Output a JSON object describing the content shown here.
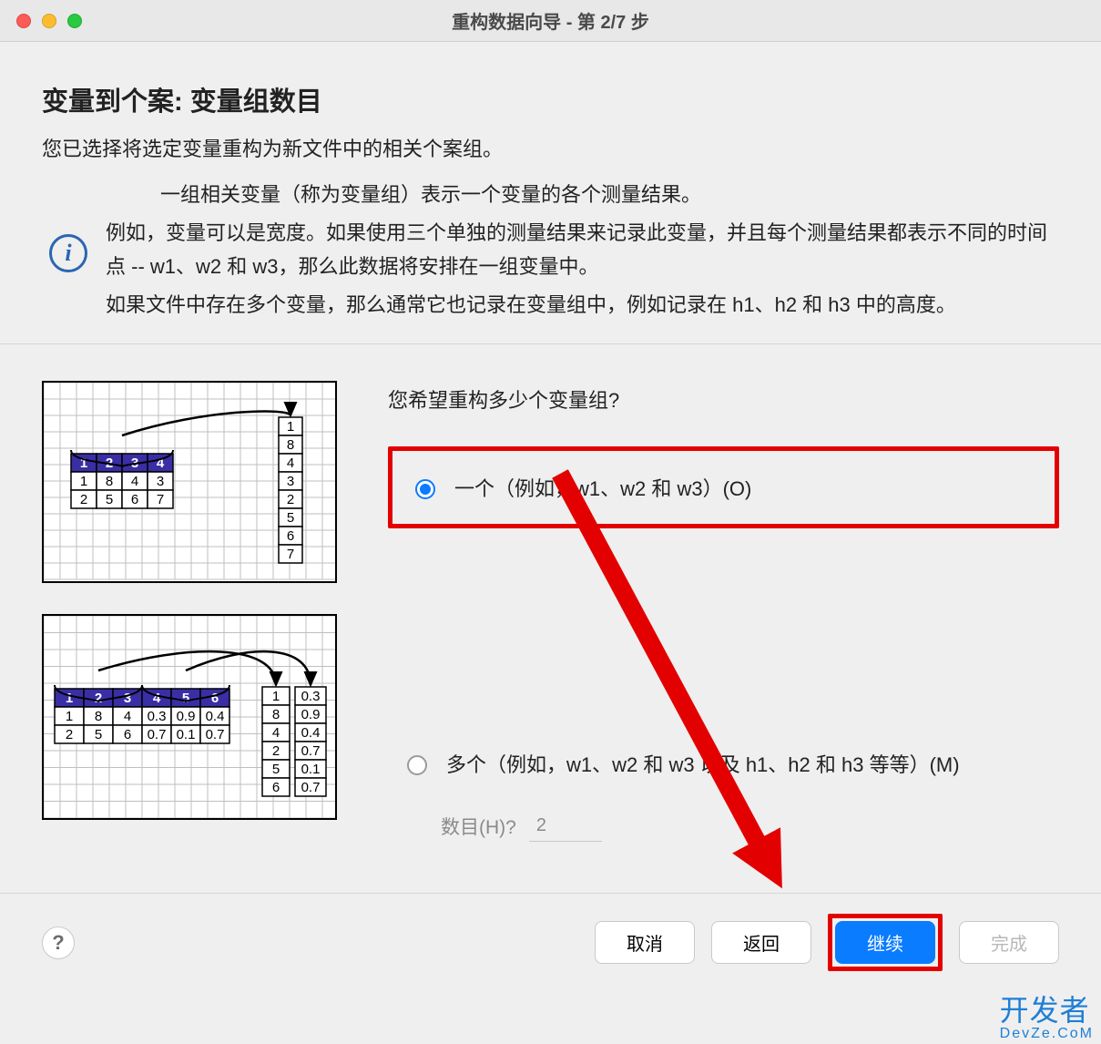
{
  "window": {
    "title": "重构数据向导 - 第 2/7 步"
  },
  "heading": "变量到个案: 变量组数目",
  "intro": "您已选择将选定变量重构为新文件中的相关个案组。",
  "explanation": {
    "p1": "一组相关变量（称为变量组）表示一个变量的各个测量结果。",
    "p2": "例如，变量可以是宽度。如果使用三个单独的测量结果来记录此变量，并且每个测量结果都表示不同的时间点 -- w1、w2 和 w3，那么此数据将安排在一组变量中。",
    "p3": "如果文件中存在多个变量，那么通常它也记录在变量组中，例如记录在 h1、h2 和 h3 中的高度。"
  },
  "prompt": "您希望重构多少个变量组?",
  "options": {
    "one": "一个（例如，w1、w2 和 w3）(O)",
    "multi": "多个（例如，w1、w2 和 w3 以及 h1、h2 和 h3 等等）(M)",
    "multi_count_label": "数目(H)?",
    "multi_count_value": "2"
  },
  "buttons": {
    "help": "?",
    "cancel": "取消",
    "back": "返回",
    "continue": "继续",
    "finish": "完成"
  },
  "illustration": {
    "top": {
      "header": [
        "1",
        "2",
        "3",
        "4"
      ],
      "rows": [
        [
          "1",
          "8",
          "4",
          "3"
        ],
        [
          "2",
          "5",
          "6",
          "7"
        ]
      ],
      "column": [
        "1",
        "8",
        "4",
        "3",
        "2",
        "5",
        "6",
        "7"
      ]
    },
    "bottom": {
      "header": [
        "1",
        "2",
        "3",
        "4",
        "5",
        "6"
      ],
      "rows": [
        [
          "1",
          "8",
          "4",
          "0.3",
          "0.9",
          "0.4"
        ],
        [
          "2",
          "5",
          "6",
          "0.7",
          "0.1",
          "0.7"
        ]
      ],
      "columns": [
        [
          "1",
          "8",
          "4",
          "2",
          "5",
          "6"
        ],
        [
          "0.3",
          "0.9",
          "0.4",
          "0.7",
          "0.1",
          "0.7"
        ]
      ]
    }
  },
  "watermark": {
    "cn": "开发者",
    "en": "DevZe.CoM"
  }
}
